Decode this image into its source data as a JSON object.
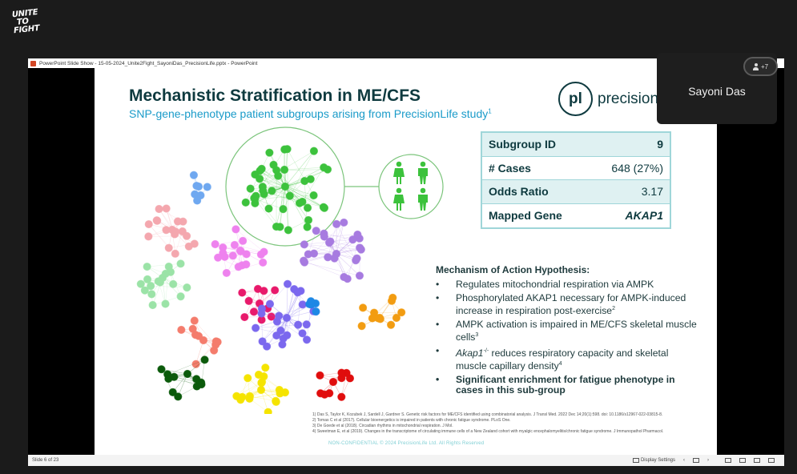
{
  "brand_logo": {
    "lines": [
      "UNITE",
      "TO",
      "FIGHT"
    ]
  },
  "window": {
    "title": "PowerPoint Slide Show  -  15-05-2024_Unite2Fight_SayoniDas_PrecisionLife.pptx  -  PowerPoint"
  },
  "slide": {
    "title": "Mechanistic Stratification in ME/CFS",
    "subtitle": "SNP-gene-phenotype patient subgroups arising from PrecisionLife study",
    "subtitle_ref": "1",
    "brand": {
      "mark": "pl",
      "text": "precision"
    },
    "table": [
      {
        "key": "Subgroup ID",
        "value": "9"
      },
      {
        "key": "# Cases",
        "value": "648 (27%)"
      },
      {
        "key": "Odds Ratio",
        "value": "3.17"
      },
      {
        "key": "Mapped Gene",
        "value": "AKAP1"
      }
    ],
    "hypothesis": {
      "title": "Mechanism of Action Hypothesis:",
      "bullet": "•",
      "items": [
        {
          "text": "Regulates mitochondrial respiration via AMPK",
          "ref": ""
        },
        {
          "text": "Phosphorylated AKAP1 necessary for AMPK-induced increase in respiration post-exercise",
          "ref": "2"
        },
        {
          "text": "AMPK activation is impaired in ME/CFS skeletal muscle cells",
          "ref": "3"
        },
        {
          "prefix": "Akap1",
          "prefix_sup": "-/-",
          "text": " reduces respiratory capacity and skeletal muscle capillary density",
          "ref": "4"
        },
        {
          "text": "Significant enrichment for fatigue phenotype in cases in this sub-group",
          "ref": ""
        }
      ]
    },
    "references": [
      "1)  Das S, Taylor K, Kozubek J, Sardell J, Gardner S. Genetic risk factors for ME/CFS identified using combinatorial analysis. J Transl Med. 2022 Dec 14;20(1):598. doi: 10.1186/s12967-022-03815-8.",
      "2)  Tomas C et al (2017). Cellular bioenergetics is impaired in patients with chronic fatigue syndrome. PLoS One.",
      "3)  De Goede et al (2018). Circadian rhythms in mitochondrial respiration. J Mol.",
      "4)  Sweetman E, et al (2019). Changes in the transcriptome of circulating immune cells of a New Zealand cohort with myalgic encephalomyelitis/chronic fatigue syndrome. J Immunopathol Pharmacol."
    ],
    "footer": "NON-CONFIDENTIAL © 2024 PrecisionLife Ltd. All Rights Reserved",
    "network_clusters": [
      {
        "name": "green-subgroup-9",
        "color": "#3cc23c",
        "nodes": 40,
        "highlighted": true
      },
      {
        "name": "blue",
        "color": "#6fa8f0",
        "nodes": 6
      },
      {
        "name": "light-pink",
        "color": "#f4a7ae",
        "nodes": 17
      },
      {
        "name": "magenta",
        "color": "#ee82ee",
        "nodes": 18
      },
      {
        "name": "purple",
        "color": "#a77be0",
        "nodes": 24
      },
      {
        "name": "light-green",
        "color": "#9be3a7",
        "nodes": 17
      },
      {
        "name": "crimson",
        "color": "#e8196b",
        "nodes": 10
      },
      {
        "name": "violet",
        "color": "#7b68ee",
        "nodes": 24
      },
      {
        "name": "bright-blue",
        "color": "#1e88e5",
        "nodes": 4
      },
      {
        "name": "orange",
        "color": "#f29c11",
        "nodes": 11
      },
      {
        "name": "salmon",
        "color": "#f47c6c",
        "nodes": 10
      },
      {
        "name": "dark-green",
        "color": "#0b5a0b",
        "nodes": 12
      },
      {
        "name": "yellow",
        "color": "#f5e400",
        "nodes": 17
      },
      {
        "name": "red",
        "color": "#e00d0d",
        "nodes": 9
      }
    ],
    "population_icons": [
      "female",
      "male",
      "female",
      "male"
    ]
  },
  "status_bar": {
    "slide_counter": "Slide 6 of 23",
    "display_settings": "Display Settings",
    "prev": "‹",
    "next": "›"
  },
  "participant": {
    "name": "Sayoni Das",
    "badge_count": "+7"
  }
}
